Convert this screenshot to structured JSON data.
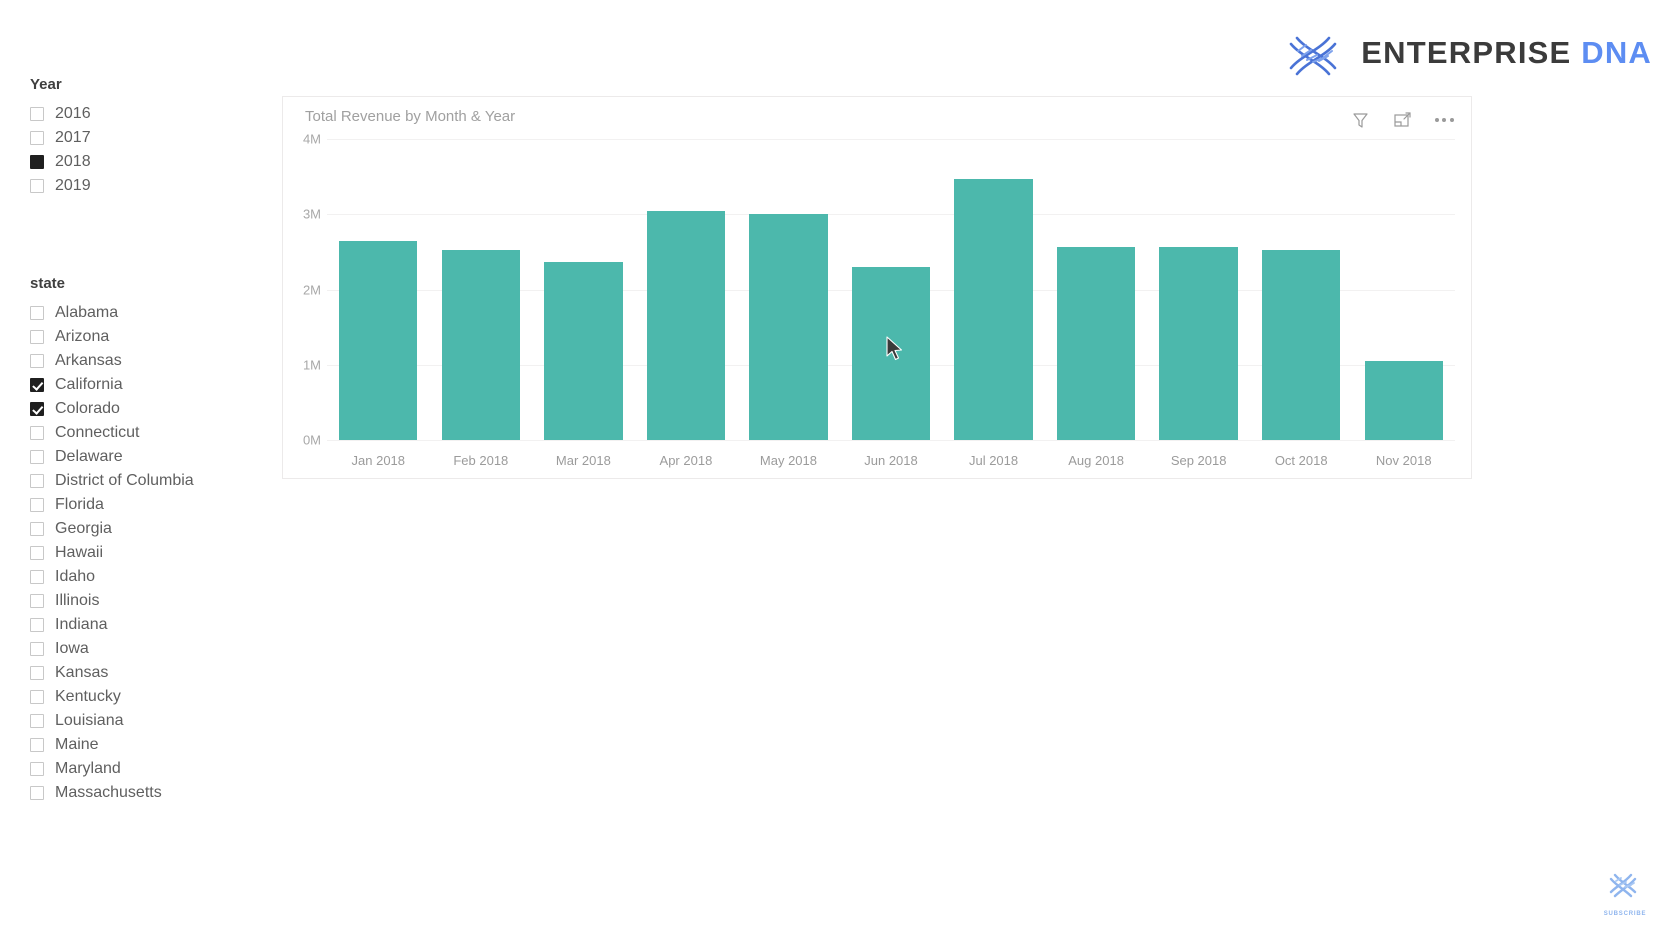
{
  "brand": {
    "name_primary": "ENTERPRISE",
    "name_secondary": "DNA",
    "helix_icon": "dna-helix-icon"
  },
  "year_slicer": {
    "title": "Year",
    "items": [
      {
        "label": "2016",
        "state": "unchecked"
      },
      {
        "label": "2017",
        "state": "unchecked"
      },
      {
        "label": "2018",
        "state": "filled"
      },
      {
        "label": "2019",
        "state": "unchecked"
      }
    ]
  },
  "state_slicer": {
    "title": "state",
    "items": [
      {
        "label": "Alabama",
        "state": "unchecked"
      },
      {
        "label": "Arizona",
        "state": "unchecked"
      },
      {
        "label": "Arkansas",
        "state": "unchecked"
      },
      {
        "label": "California",
        "state": "checked"
      },
      {
        "label": "Colorado",
        "state": "checked"
      },
      {
        "label": "Connecticut",
        "state": "unchecked"
      },
      {
        "label": "Delaware",
        "state": "unchecked"
      },
      {
        "label": "District of Columbia",
        "state": "unchecked"
      },
      {
        "label": "Florida",
        "state": "unchecked"
      },
      {
        "label": "Georgia",
        "state": "unchecked"
      },
      {
        "label": "Hawaii",
        "state": "unchecked"
      },
      {
        "label": "Idaho",
        "state": "unchecked"
      },
      {
        "label": "Illinois",
        "state": "unchecked"
      },
      {
        "label": "Indiana",
        "state": "unchecked"
      },
      {
        "label": "Iowa",
        "state": "unchecked"
      },
      {
        "label": "Kansas",
        "state": "unchecked"
      },
      {
        "label": "Kentucky",
        "state": "unchecked"
      },
      {
        "label": "Louisiana",
        "state": "unchecked"
      },
      {
        "label": "Maine",
        "state": "unchecked"
      },
      {
        "label": "Maryland",
        "state": "unchecked"
      },
      {
        "label": "Massachusetts",
        "state": "unchecked"
      }
    ]
  },
  "card": {
    "title": "Total Revenue by Month & Year",
    "icons": [
      {
        "name": "filter-icon"
      },
      {
        "name": "focus-mode-icon"
      },
      {
        "name": "more-options-icon"
      }
    ]
  },
  "subscribe": {
    "label": "SUBSCRIBE",
    "icon": "dna-helix-icon"
  },
  "colors": {
    "bar": "#4cb8ac",
    "brand_primary": "#3b3b3b",
    "brand_secondary": "#5d8df2",
    "checkbox_checked": "#1f1f1f",
    "gridline": "#f2f1f1",
    "axis_text": "#9b9b9b"
  },
  "chart_data": {
    "type": "bar",
    "title": "Total Revenue by Month & Year",
    "xlabel": "",
    "ylabel": "",
    "categories": [
      "Jan 2018",
      "Feb 2018",
      "Mar 2018",
      "Apr 2018",
      "May 2018",
      "Jun 2018",
      "Jul 2018",
      "Aug 2018",
      "Sep 2018",
      "Oct 2018",
      "Nov 2018"
    ],
    "values": [
      2.65,
      2.52,
      2.37,
      3.05,
      3.0,
      2.3,
      3.47,
      2.57,
      2.57,
      2.52,
      1.05
    ],
    "value_unit": "M",
    "ylim": [
      0,
      4
    ],
    "yticks": [
      0,
      1,
      2,
      3,
      4
    ],
    "ytick_labels": [
      "0M",
      "1M",
      "2M",
      "3M",
      "4M"
    ],
    "grid": true,
    "legend": false,
    "series_color": "#4cb8ac"
  }
}
